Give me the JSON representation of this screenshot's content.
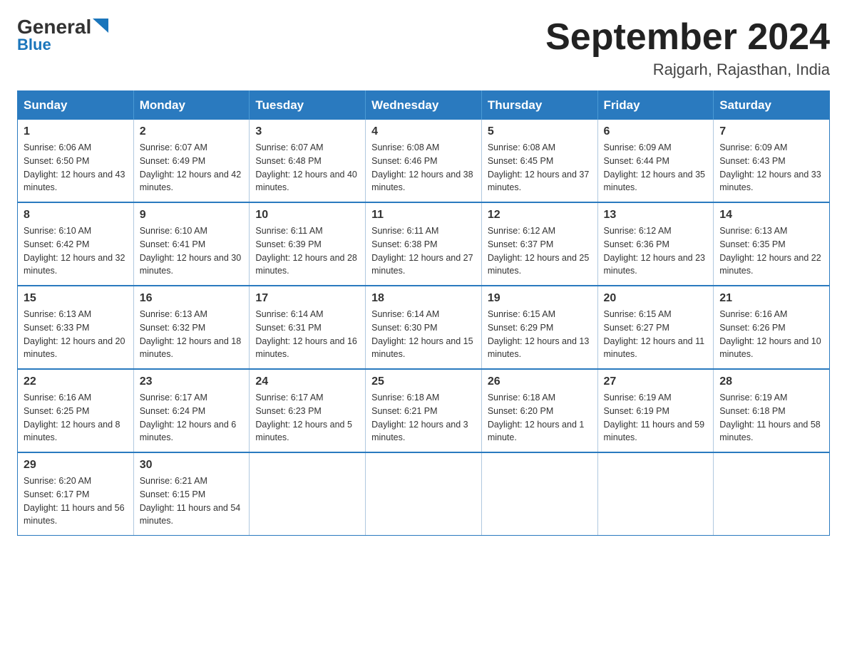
{
  "logo": {
    "general": "General",
    "blue": "Blue"
  },
  "title": {
    "month_year": "September 2024",
    "location": "Rajgarh, Rajasthan, India"
  },
  "headers": [
    "Sunday",
    "Monday",
    "Tuesday",
    "Wednesday",
    "Thursday",
    "Friday",
    "Saturday"
  ],
  "weeks": [
    [
      {
        "day": "1",
        "sunrise": "6:06 AM",
        "sunset": "6:50 PM",
        "daylight": "12 hours and 43 minutes."
      },
      {
        "day": "2",
        "sunrise": "6:07 AM",
        "sunset": "6:49 PM",
        "daylight": "12 hours and 42 minutes."
      },
      {
        "day": "3",
        "sunrise": "6:07 AM",
        "sunset": "6:48 PM",
        "daylight": "12 hours and 40 minutes."
      },
      {
        "day": "4",
        "sunrise": "6:08 AM",
        "sunset": "6:46 PM",
        "daylight": "12 hours and 38 minutes."
      },
      {
        "day": "5",
        "sunrise": "6:08 AM",
        "sunset": "6:45 PM",
        "daylight": "12 hours and 37 minutes."
      },
      {
        "day": "6",
        "sunrise": "6:09 AM",
        "sunset": "6:44 PM",
        "daylight": "12 hours and 35 minutes."
      },
      {
        "day": "7",
        "sunrise": "6:09 AM",
        "sunset": "6:43 PM",
        "daylight": "12 hours and 33 minutes."
      }
    ],
    [
      {
        "day": "8",
        "sunrise": "6:10 AM",
        "sunset": "6:42 PM",
        "daylight": "12 hours and 32 minutes."
      },
      {
        "day": "9",
        "sunrise": "6:10 AM",
        "sunset": "6:41 PM",
        "daylight": "12 hours and 30 minutes."
      },
      {
        "day": "10",
        "sunrise": "6:11 AM",
        "sunset": "6:39 PM",
        "daylight": "12 hours and 28 minutes."
      },
      {
        "day": "11",
        "sunrise": "6:11 AM",
        "sunset": "6:38 PM",
        "daylight": "12 hours and 27 minutes."
      },
      {
        "day": "12",
        "sunrise": "6:12 AM",
        "sunset": "6:37 PM",
        "daylight": "12 hours and 25 minutes."
      },
      {
        "day": "13",
        "sunrise": "6:12 AM",
        "sunset": "6:36 PM",
        "daylight": "12 hours and 23 minutes."
      },
      {
        "day": "14",
        "sunrise": "6:13 AM",
        "sunset": "6:35 PM",
        "daylight": "12 hours and 22 minutes."
      }
    ],
    [
      {
        "day": "15",
        "sunrise": "6:13 AM",
        "sunset": "6:33 PM",
        "daylight": "12 hours and 20 minutes."
      },
      {
        "day": "16",
        "sunrise": "6:13 AM",
        "sunset": "6:32 PM",
        "daylight": "12 hours and 18 minutes."
      },
      {
        "day": "17",
        "sunrise": "6:14 AM",
        "sunset": "6:31 PM",
        "daylight": "12 hours and 16 minutes."
      },
      {
        "day": "18",
        "sunrise": "6:14 AM",
        "sunset": "6:30 PM",
        "daylight": "12 hours and 15 minutes."
      },
      {
        "day": "19",
        "sunrise": "6:15 AM",
        "sunset": "6:29 PM",
        "daylight": "12 hours and 13 minutes."
      },
      {
        "day": "20",
        "sunrise": "6:15 AM",
        "sunset": "6:27 PM",
        "daylight": "12 hours and 11 minutes."
      },
      {
        "day": "21",
        "sunrise": "6:16 AM",
        "sunset": "6:26 PM",
        "daylight": "12 hours and 10 minutes."
      }
    ],
    [
      {
        "day": "22",
        "sunrise": "6:16 AM",
        "sunset": "6:25 PM",
        "daylight": "12 hours and 8 minutes."
      },
      {
        "day": "23",
        "sunrise": "6:17 AM",
        "sunset": "6:24 PM",
        "daylight": "12 hours and 6 minutes."
      },
      {
        "day": "24",
        "sunrise": "6:17 AM",
        "sunset": "6:23 PM",
        "daylight": "12 hours and 5 minutes."
      },
      {
        "day": "25",
        "sunrise": "6:18 AM",
        "sunset": "6:21 PM",
        "daylight": "12 hours and 3 minutes."
      },
      {
        "day": "26",
        "sunrise": "6:18 AM",
        "sunset": "6:20 PM",
        "daylight": "12 hours and 1 minute."
      },
      {
        "day": "27",
        "sunrise": "6:19 AM",
        "sunset": "6:19 PM",
        "daylight": "11 hours and 59 minutes."
      },
      {
        "day": "28",
        "sunrise": "6:19 AM",
        "sunset": "6:18 PM",
        "daylight": "11 hours and 58 minutes."
      }
    ],
    [
      {
        "day": "29",
        "sunrise": "6:20 AM",
        "sunset": "6:17 PM",
        "daylight": "11 hours and 56 minutes."
      },
      {
        "day": "30",
        "sunrise": "6:21 AM",
        "sunset": "6:15 PM",
        "daylight": "11 hours and 54 minutes."
      },
      null,
      null,
      null,
      null,
      null
    ]
  ]
}
